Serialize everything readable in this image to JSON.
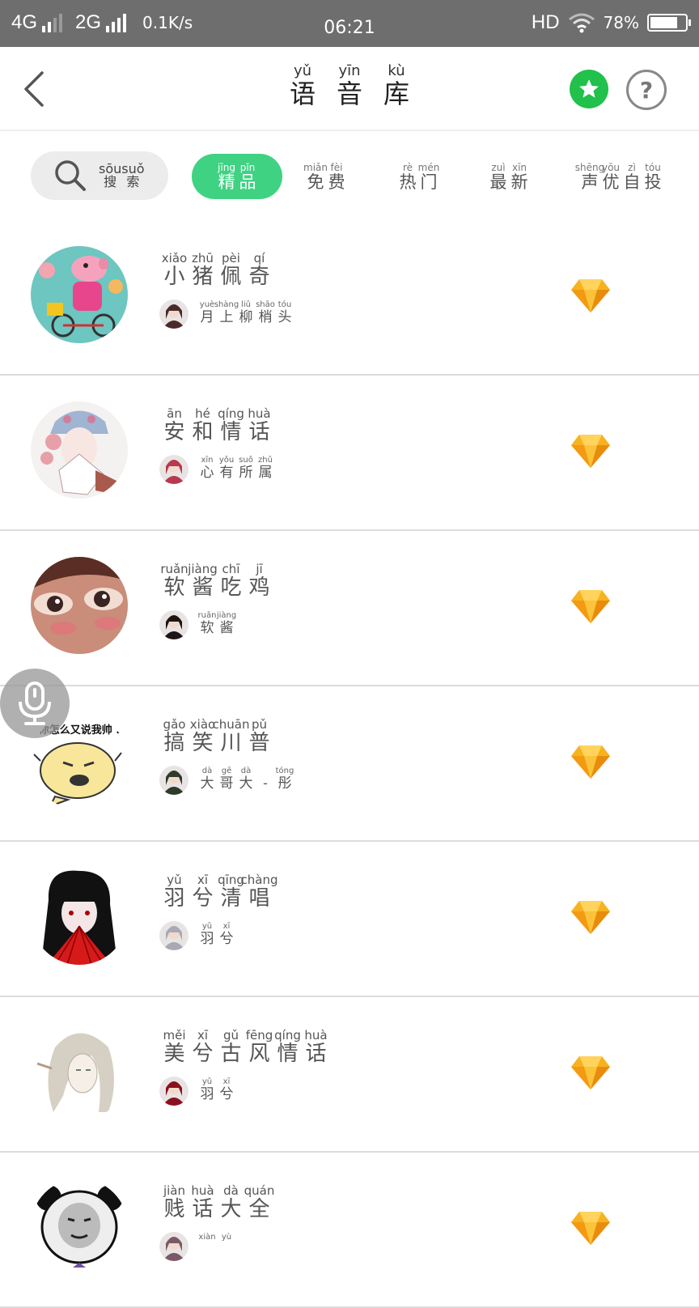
{
  "status_bar": {
    "network1": "4G",
    "network2": "2G",
    "speed": "0.1K/s",
    "time": "06:21",
    "hd": "HD",
    "battery_pct": "78%",
    "battery_level": 0.78
  },
  "header": {
    "title": [
      {
        "py": "yǔ",
        "hz": "语"
      },
      {
        "py": "yīn",
        "hz": "音"
      },
      {
        "py": "kù",
        "hz": "库"
      }
    ],
    "back_icon": "chevron-left-icon",
    "favorites_icon": "star-icon",
    "help_icon": "question-icon",
    "help_label": "?",
    "accent": "#21c14b"
  },
  "tabs": {
    "search": [
      {
        "py": "sōu",
        "hz": "搜"
      },
      {
        "py": "suǒ",
        "hz": "索"
      }
    ],
    "items": [
      {
        "chars": [
          {
            "py": "jīng",
            "hz": "精"
          },
          {
            "py": "pǐn",
            "hz": "品"
          }
        ],
        "active": true
      },
      {
        "chars": [
          {
            "py": "miǎn",
            "hz": "免"
          },
          {
            "py": "fèi",
            "hz": "费"
          }
        ],
        "active": false
      },
      {
        "chars": [
          {
            "py": "rè",
            "hz": "热"
          },
          {
            "py": "mén",
            "hz": "门"
          }
        ],
        "active": false
      },
      {
        "chars": [
          {
            "py": "zuì",
            "hz": "最"
          },
          {
            "py": "xīn",
            "hz": "新"
          }
        ],
        "active": false
      },
      {
        "chars": [
          {
            "py": "shēng",
            "hz": "声"
          },
          {
            "py": "yōu",
            "hz": "优"
          },
          {
            "py": "zì",
            "hz": "自"
          },
          {
            "py": "tóu",
            "hz": "投"
          }
        ],
        "active": false
      }
    ],
    "active_color": "#3fd282"
  },
  "list": [
    {
      "name": [
        {
          "py": "xiǎo",
          "hz": "小"
        },
        {
          "py": "zhū",
          "hz": "猪"
        },
        {
          "py": "pèi",
          "hz": "佩"
        },
        {
          "py": "qí",
          "hz": "奇"
        }
      ],
      "author": [
        {
          "py": "yuè",
          "hz": "月"
        },
        {
          "py": "shàng",
          "hz": "上"
        },
        {
          "py": "liǔ",
          "hz": "柳"
        },
        {
          "py": "shāo",
          "hz": "梢"
        },
        {
          "py": "tóu",
          "hz": "头"
        }
      ],
      "avatar": "peppa-pig",
      "badge": "diamond-icon"
    },
    {
      "name": [
        {
          "py": "ān",
          "hz": "安"
        },
        {
          "py": "hé",
          "hz": "和"
        },
        {
          "py": "qíng",
          "hz": "情"
        },
        {
          "py": "huà",
          "hz": "话"
        }
      ],
      "author": [
        {
          "py": "xīn",
          "hz": "心"
        },
        {
          "py": "yǒu",
          "hz": "有"
        },
        {
          "py": "suǒ",
          "hz": "所"
        },
        {
          "py": "zhǔ",
          "hz": "属"
        }
      ],
      "avatar": "opera-girl",
      "badge": "diamond-icon"
    },
    {
      "name": [
        {
          "py": "ruǎn",
          "hz": "软"
        },
        {
          "py": "jiàng",
          "hz": "酱"
        },
        {
          "py": "chī",
          "hz": "吃"
        },
        {
          "py": "jī",
          "hz": "鸡"
        }
      ],
      "author": [
        {
          "py": "ruǎn",
          "hz": "软"
        },
        {
          "py": "jiàng",
          "hz": "酱"
        }
      ],
      "avatar": "anime-eyes",
      "badge": "diamond-icon"
    },
    {
      "name": [
        {
          "py": "gǎo",
          "hz": "搞"
        },
        {
          "py": "xiào",
          "hz": "笑"
        },
        {
          "py": "chuān",
          "hz": "川"
        },
        {
          "py": "pǔ",
          "hz": "普"
        }
      ],
      "author": [
        {
          "py": "dà",
          "hz": "大"
        },
        {
          "py": "gē",
          "hz": "哥"
        },
        {
          "py": "dà",
          "hz": "大"
        },
        {
          "py": "",
          "hz": "-"
        },
        {
          "py": "tóng",
          "hz": "彤"
        }
      ],
      "avatar": "meme-face",
      "avatar_text": "你怎么又说我帅 .",
      "badge": "diamond-icon"
    },
    {
      "name": [
        {
          "py": "yǔ",
          "hz": "羽"
        },
        {
          "py": "xī",
          "hz": "兮"
        },
        {
          "py": "qīng",
          "hz": "清"
        },
        {
          "py": "chàng",
          "hz": "唱"
        }
      ],
      "author": [
        {
          "py": "yǔ",
          "hz": "羽"
        },
        {
          "py": "xī",
          "hz": "兮"
        }
      ],
      "avatar": "fan-girl",
      "badge": "diamond-icon"
    },
    {
      "name": [
        {
          "py": "měi",
          "hz": "美"
        },
        {
          "py": "xī",
          "hz": "兮"
        },
        {
          "py": "gǔ",
          "hz": "古"
        },
        {
          "py": "fēng",
          "hz": "风"
        },
        {
          "py": "qíng",
          "hz": "情"
        },
        {
          "py": "huà",
          "hz": "话"
        }
      ],
      "author": [
        {
          "py": "yǔ",
          "hz": "羽"
        },
        {
          "py": "xī",
          "hz": "兮"
        }
      ],
      "avatar": "sketch-man",
      "badge": "diamond-icon"
    },
    {
      "name": [
        {
          "py": "jiàn",
          "hz": "贱"
        },
        {
          "py": "huà",
          "hz": "话"
        },
        {
          "py": "dà",
          "hz": "大"
        },
        {
          "py": "quán",
          "hz": "全"
        }
      ],
      "author": [
        {
          "py": "xiàn",
          "hz": ""
        },
        {
          "py": "yù",
          "hz": ""
        }
      ],
      "avatar": "panda-meme",
      "badge": "diamond-icon"
    }
  ],
  "floating": {
    "mic_icon": "microphone-icon"
  },
  "colors": {
    "gem": "#f7b21f",
    "divider": "#dcdcdc"
  }
}
